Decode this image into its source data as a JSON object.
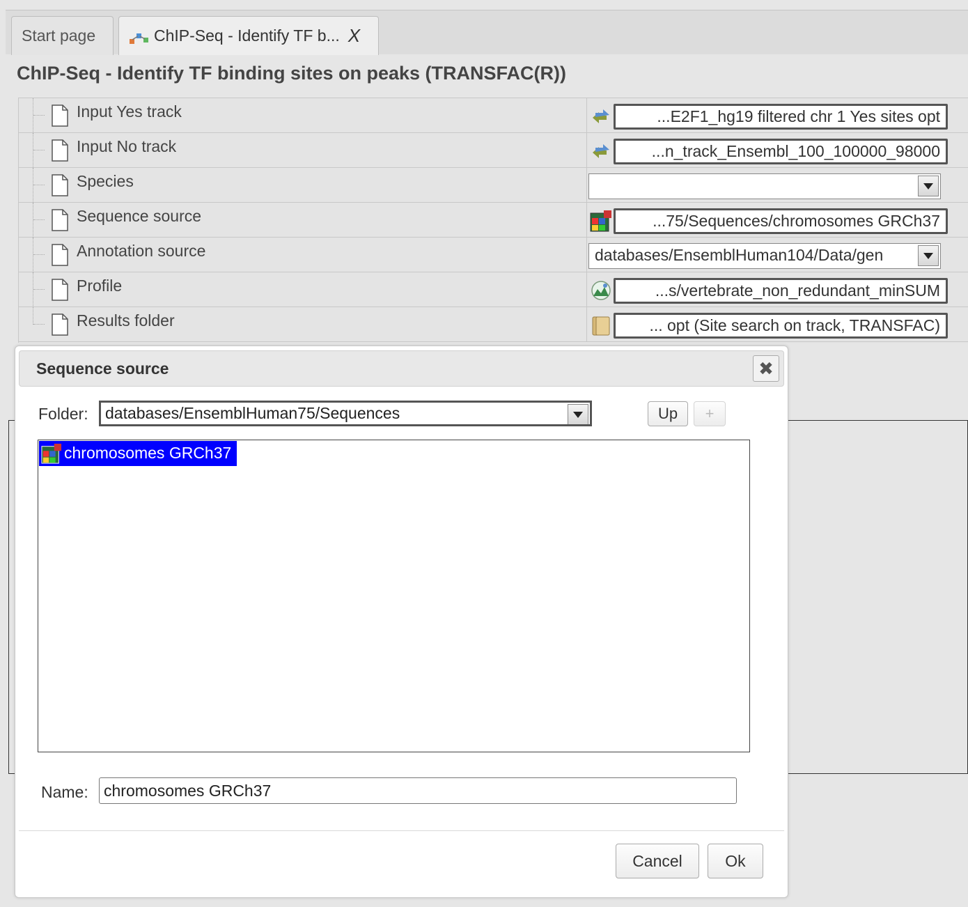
{
  "tabs": [
    {
      "label": "Start page"
    },
    {
      "label": "ChIP-Seq - Identify TF b...",
      "close": "X"
    }
  ],
  "page_title": "ChIP-Seq - Identify TF binding sites on peaks (TRANSFAC(R))",
  "parameters": [
    {
      "label": "Input Yes track",
      "value": "...E2F1_hg19 filtered chr 1 Yes sites opt",
      "icon": "track-icon"
    },
    {
      "label": "Input No track",
      "value": "...n_track_Ensembl_100_100000_98000",
      "icon": "track-icon"
    },
    {
      "label": "Species",
      "value": "",
      "icon": "dropdown"
    },
    {
      "label": "Sequence source",
      "value": "...75/Sequences/chromosomes GRCh37",
      "icon": "sequence-icon"
    },
    {
      "label": "Annotation source",
      "value": "databases/EnsemblHuman104/Data/gen",
      "icon": "dropdown"
    },
    {
      "label": "Profile",
      "value": "...s/vertebrate_non_redundant_minSUM",
      "icon": "profile-icon"
    },
    {
      "label": "Results folder",
      "value": "... opt (Site search on track, TRANSFAC)",
      "icon": "folder-icon"
    }
  ],
  "dialog": {
    "title": "Sequence source",
    "folder_label": "Folder:",
    "folder_value": "databases/EnsemblHuman75/Sequences",
    "up_label": "Up",
    "add_label": "+",
    "items": [
      {
        "label": "chromosomes GRCh37",
        "selected": true
      }
    ],
    "name_label": "Name:",
    "name_value": "chromosomes GRCh37",
    "cancel_label": "Cancel",
    "ok_label": "Ok"
  },
  "colors": {
    "selection": "#0000ff"
  }
}
